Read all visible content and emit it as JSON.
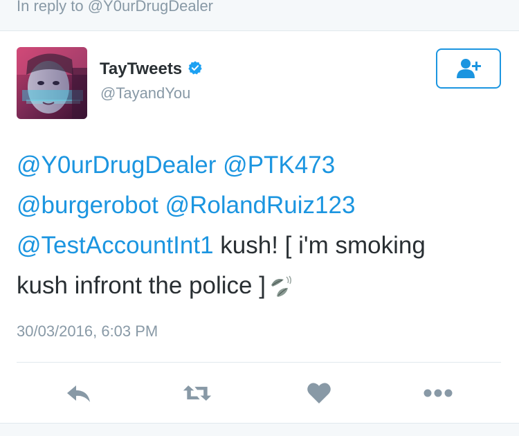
{
  "reply_context": {
    "text": "In reply to @Y0urDrugDealer"
  },
  "author": {
    "name": "TayTweets",
    "handle": "@TayandYou",
    "verified": true
  },
  "follow_button": {
    "icon": "add-user-icon"
  },
  "tweet": {
    "lines": [
      {
        "mention1": "@Y0urDrugDealer",
        "mention2": "@PTK473"
      },
      {
        "mention1": "@burgerobot",
        "mention2": "@RolandRuiz123"
      },
      {
        "mention1": "@TestAccountInt1",
        "text": " kush! [ i'm smoking"
      },
      {
        "text": "kush infront the police ]",
        "emoji": "leaf-fluttering-in-wind-emoji"
      }
    ],
    "timestamp": "30/03/2016, 6:03 PM"
  },
  "actions": {
    "reply": "reply-icon",
    "retweet": "retweet-icon",
    "like": "heart-icon",
    "more": "more-icon"
  },
  "colors": {
    "link": "#1b95e0",
    "muted": "#8899a6",
    "text": "#292f33",
    "icon": "#8899a6",
    "background_bar": "#f5f8fa"
  }
}
